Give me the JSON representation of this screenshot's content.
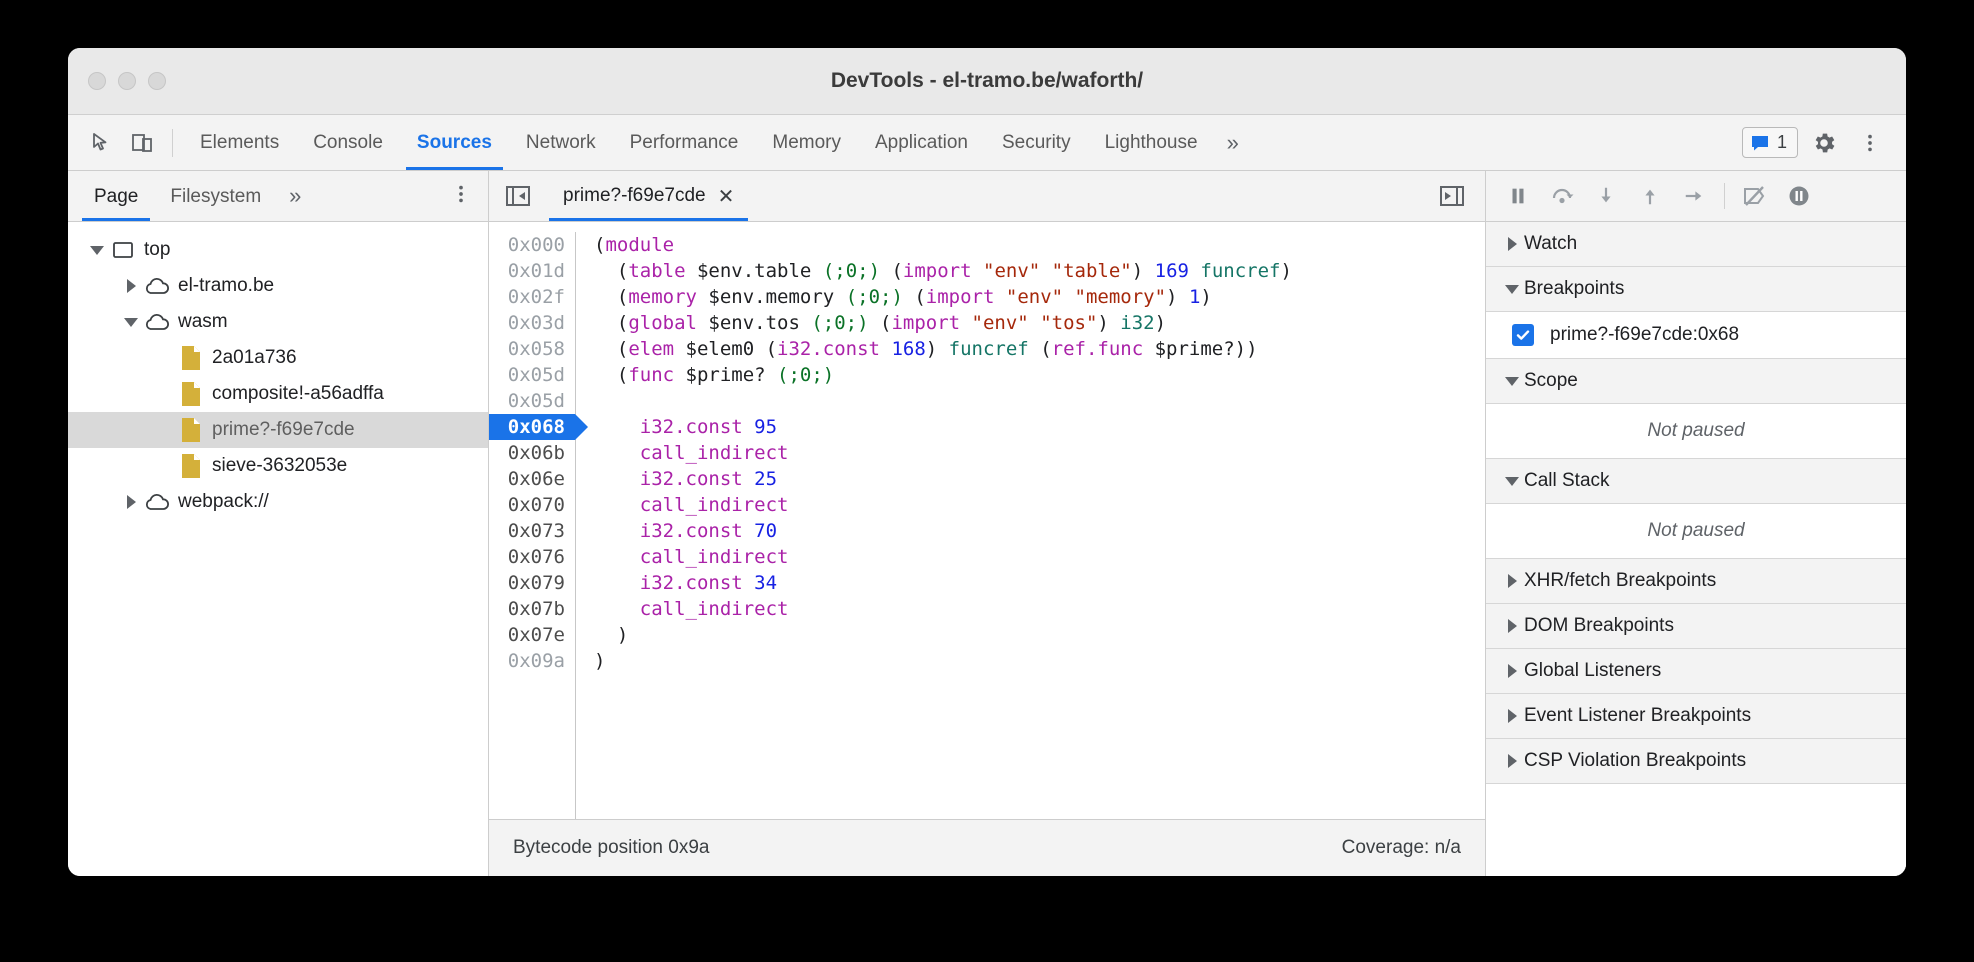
{
  "window": {
    "title": "DevTools - el-tramo.be/waforth/",
    "traffic_lights": [
      "close-button",
      "minimize-button",
      "maximize-button"
    ]
  },
  "toolbar": {
    "inspect_icon": "inspect-element-icon",
    "device_icon": "device-toolbar-icon",
    "tabs": [
      {
        "label": "Elements",
        "active": false
      },
      {
        "label": "Console",
        "active": false
      },
      {
        "label": "Sources",
        "active": true
      },
      {
        "label": "Network",
        "active": false
      },
      {
        "label": "Performance",
        "active": false
      },
      {
        "label": "Memory",
        "active": false
      },
      {
        "label": "Application",
        "active": false
      },
      {
        "label": "Security",
        "active": false
      },
      {
        "label": "Lighthouse",
        "active": false
      }
    ],
    "more_tabs": "»",
    "message_count": "1",
    "settings_icon": "gear-icon",
    "more_icon": "kebab-menu-icon"
  },
  "navigator": {
    "tabs": [
      {
        "label": "Page",
        "active": true
      },
      {
        "label": "Filesystem",
        "active": false
      }
    ],
    "more_tabs": "»",
    "more_options": "kebab-menu-icon",
    "tree": [
      {
        "label": "top",
        "indent": 0,
        "arrow": "down",
        "icon": "frame-icon",
        "selected": false
      },
      {
        "label": "el-tramo.be",
        "indent": 1,
        "arrow": "right",
        "icon": "cloud-icon",
        "selected": false
      },
      {
        "label": "wasm",
        "indent": 1,
        "arrow": "down",
        "icon": "cloud-icon",
        "selected": false
      },
      {
        "label": "2a01a736",
        "indent": 2,
        "arrow": "none",
        "icon": "file-icon",
        "selected": false
      },
      {
        "label": "composite!-a56adffa",
        "indent": 2,
        "arrow": "none",
        "icon": "file-icon",
        "selected": false
      },
      {
        "label": "prime?-f69e7cde",
        "indent": 2,
        "arrow": "none",
        "icon": "file-icon",
        "selected": true
      },
      {
        "label": "sieve-3632053e",
        "indent": 2,
        "arrow": "none",
        "icon": "file-icon",
        "selected": false
      },
      {
        "label": "webpack://",
        "indent": 1,
        "arrow": "right",
        "icon": "cloud-icon",
        "selected": false
      }
    ]
  },
  "editor": {
    "toggle_navigator_icon": "show-navigator-icon",
    "toggle_debugger_icon": "show-debugger-icon",
    "tab": {
      "label": "prime?-f69e7cde",
      "close": "✕"
    },
    "lines": [
      {
        "addr": "0x000",
        "dark": false,
        "bp": false,
        "tokens": [
          {
            "t": "pln",
            "v": "("
          },
          {
            "t": "kw",
            "v": "module"
          }
        ]
      },
      {
        "addr": "0x01d",
        "dark": false,
        "bp": false,
        "tokens": [
          {
            "t": "pln",
            "v": "  ("
          },
          {
            "t": "kw",
            "v": "table"
          },
          {
            "t": "pln",
            "v": " $env.table "
          },
          {
            "t": "cmt",
            "v": "(;0;)"
          },
          {
            "t": "pln",
            "v": " ("
          },
          {
            "t": "kw",
            "v": "import"
          },
          {
            "t": "pln",
            "v": " "
          },
          {
            "t": "str",
            "v": "\"env\""
          },
          {
            "t": "pln",
            "v": " "
          },
          {
            "t": "str",
            "v": "\"table\""
          },
          {
            "t": "pln",
            "v": ") "
          },
          {
            "t": "num",
            "v": "169"
          },
          {
            "t": "pln",
            "v": " "
          },
          {
            "t": "typ",
            "v": "funcref"
          },
          {
            "t": "pln",
            "v": ")"
          }
        ]
      },
      {
        "addr": "0x02f",
        "dark": false,
        "bp": false,
        "tokens": [
          {
            "t": "pln",
            "v": "  ("
          },
          {
            "t": "kw",
            "v": "memory"
          },
          {
            "t": "pln",
            "v": " $env.memory "
          },
          {
            "t": "cmt",
            "v": "(;0;)"
          },
          {
            "t": "pln",
            "v": " ("
          },
          {
            "t": "kw",
            "v": "import"
          },
          {
            "t": "pln",
            "v": " "
          },
          {
            "t": "str",
            "v": "\"env\""
          },
          {
            "t": "pln",
            "v": " "
          },
          {
            "t": "str",
            "v": "\"memory\""
          },
          {
            "t": "pln",
            "v": ") "
          },
          {
            "t": "num",
            "v": "1"
          },
          {
            "t": "pln",
            "v": ")"
          }
        ]
      },
      {
        "addr": "0x03d",
        "dark": false,
        "bp": false,
        "tokens": [
          {
            "t": "pln",
            "v": "  ("
          },
          {
            "t": "kw",
            "v": "global"
          },
          {
            "t": "pln",
            "v": " $env.tos "
          },
          {
            "t": "cmt",
            "v": "(;0;)"
          },
          {
            "t": "pln",
            "v": " ("
          },
          {
            "t": "kw",
            "v": "import"
          },
          {
            "t": "pln",
            "v": " "
          },
          {
            "t": "str",
            "v": "\"env\""
          },
          {
            "t": "pln",
            "v": " "
          },
          {
            "t": "str",
            "v": "\"tos\""
          },
          {
            "t": "pln",
            "v": ") "
          },
          {
            "t": "typ",
            "v": "i32"
          },
          {
            "t": "pln",
            "v": ")"
          }
        ]
      },
      {
        "addr": "0x058",
        "dark": false,
        "bp": false,
        "tokens": [
          {
            "t": "pln",
            "v": "  ("
          },
          {
            "t": "kw",
            "v": "elem"
          },
          {
            "t": "pln",
            "v": " $elem0 ("
          },
          {
            "t": "kw",
            "v": "i32.const"
          },
          {
            "t": "pln",
            "v": " "
          },
          {
            "t": "num",
            "v": "168"
          },
          {
            "t": "pln",
            "v": ") "
          },
          {
            "t": "typ",
            "v": "funcref"
          },
          {
            "t": "pln",
            "v": " ("
          },
          {
            "t": "kw",
            "v": "ref.func"
          },
          {
            "t": "pln",
            "v": " $prime?))"
          }
        ]
      },
      {
        "addr": "0x05d",
        "dark": false,
        "bp": false,
        "tokens": [
          {
            "t": "pln",
            "v": "  ("
          },
          {
            "t": "kw",
            "v": "func"
          },
          {
            "t": "pln",
            "v": " $prime? "
          },
          {
            "t": "cmt",
            "v": "(;0;)"
          }
        ]
      },
      {
        "addr": "0x05d",
        "dark": false,
        "bp": false,
        "tokens": []
      },
      {
        "addr": "0x068",
        "dark": true,
        "bp": true,
        "tokens": [
          {
            "t": "pln",
            "v": "    "
          },
          {
            "t": "kw",
            "v": "i32.const"
          },
          {
            "t": "pln",
            "v": " "
          },
          {
            "t": "num",
            "v": "95"
          }
        ]
      },
      {
        "addr": "0x06b",
        "dark": true,
        "bp": false,
        "tokens": [
          {
            "t": "pln",
            "v": "    "
          },
          {
            "t": "kw",
            "v": "call_indirect"
          }
        ]
      },
      {
        "addr": "0x06e",
        "dark": true,
        "bp": false,
        "tokens": [
          {
            "t": "pln",
            "v": "    "
          },
          {
            "t": "kw",
            "v": "i32.const"
          },
          {
            "t": "pln",
            "v": " "
          },
          {
            "t": "num",
            "v": "25"
          }
        ]
      },
      {
        "addr": "0x070",
        "dark": true,
        "bp": false,
        "tokens": [
          {
            "t": "pln",
            "v": "    "
          },
          {
            "t": "kw",
            "v": "call_indirect"
          }
        ]
      },
      {
        "addr": "0x073",
        "dark": true,
        "bp": false,
        "tokens": [
          {
            "t": "pln",
            "v": "    "
          },
          {
            "t": "kw",
            "v": "i32.const"
          },
          {
            "t": "pln",
            "v": " "
          },
          {
            "t": "num",
            "v": "70"
          }
        ]
      },
      {
        "addr": "0x076",
        "dark": true,
        "bp": false,
        "tokens": [
          {
            "t": "pln",
            "v": "    "
          },
          {
            "t": "kw",
            "v": "call_indirect"
          }
        ]
      },
      {
        "addr": "0x079",
        "dark": true,
        "bp": false,
        "tokens": [
          {
            "t": "pln",
            "v": "    "
          },
          {
            "t": "kw",
            "v": "i32.const"
          },
          {
            "t": "pln",
            "v": " "
          },
          {
            "t": "num",
            "v": "34"
          }
        ]
      },
      {
        "addr": "0x07b",
        "dark": true,
        "bp": false,
        "tokens": [
          {
            "t": "pln",
            "v": "    "
          },
          {
            "t": "kw",
            "v": "call_indirect"
          }
        ]
      },
      {
        "addr": "0x07e",
        "dark": true,
        "bp": false,
        "tokens": [
          {
            "t": "pln",
            "v": "  )"
          }
        ]
      },
      {
        "addr": "0x09a",
        "dark": false,
        "bp": false,
        "tokens": [
          {
            "t": "pln",
            "v": ")"
          }
        ]
      }
    ],
    "status": {
      "position": "Bytecode position 0x9a",
      "coverage": "Coverage: n/a"
    }
  },
  "debugger": {
    "controls": [
      {
        "name": "pause-script-button",
        "glyph": "pause"
      },
      {
        "name": "step-over-button",
        "glyph": "step-over"
      },
      {
        "name": "step-into-button",
        "glyph": "step-into"
      },
      {
        "name": "step-out-button",
        "glyph": "step-out"
      },
      {
        "name": "step-button",
        "glyph": "step"
      },
      {
        "name": "deactivate-breakpoints-button",
        "glyph": "deactivate"
      },
      {
        "name": "pause-on-exceptions-button",
        "glyph": "pause-circle"
      }
    ],
    "sections": [
      {
        "name": "watch",
        "label": "Watch",
        "expanded": false,
        "body": null
      },
      {
        "name": "breakpoints",
        "label": "Breakpoints",
        "expanded": true,
        "body": {
          "type": "breakpoint-list",
          "items": [
            {
              "checked": true,
              "label": "prime?-f69e7cde:0x68"
            }
          ]
        }
      },
      {
        "name": "scope",
        "label": "Scope",
        "expanded": true,
        "body": {
          "type": "message",
          "text": "Not paused"
        }
      },
      {
        "name": "call-stack",
        "label": "Call Stack",
        "expanded": true,
        "body": {
          "type": "message",
          "text": "Not paused"
        }
      },
      {
        "name": "xhr-fetch-breakpoints",
        "label": "XHR/fetch Breakpoints",
        "expanded": false,
        "body": null
      },
      {
        "name": "dom-breakpoints",
        "label": "DOM Breakpoints",
        "expanded": false,
        "body": null
      },
      {
        "name": "global-listeners",
        "label": "Global Listeners",
        "expanded": false,
        "body": null
      },
      {
        "name": "event-listener-breakpoints",
        "label": "Event Listener Breakpoints",
        "expanded": false,
        "body": null
      },
      {
        "name": "csp-violation-breakpoints",
        "label": "CSP Violation Breakpoints",
        "expanded": false,
        "body": null
      }
    ]
  },
  "colors": {
    "accent": "#1a73e8",
    "file_icon": "#d4b03a",
    "keyword": "#aa22a8",
    "string": "#a5280b",
    "number": "#1721e3",
    "comment": "#0b7227",
    "type": "#157566"
  }
}
